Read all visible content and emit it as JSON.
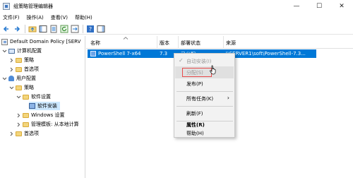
{
  "window": {
    "title": "组策略管理编辑器",
    "controls": {
      "minimize": "—",
      "maximize": "☐",
      "close": "✕"
    }
  },
  "menu": [
    "文件(F)",
    "操作(A)",
    "查看(V)",
    "帮助(H)"
  ],
  "tree": {
    "root": "Default Domain Policy [SERV",
    "computer_config": "计算机配置",
    "policies": "策略",
    "preferences": "首选项",
    "user_config": "用户配置",
    "user_policies": "策略",
    "software_settings": "软件设置",
    "software_install": "软件安装",
    "windows_settings": "Windows 设置",
    "admin_templates": "管理模板: 从本地计算",
    "user_preferences": "首选项"
  },
  "list": {
    "columns": [
      "名称",
      "版本",
      "部署状态",
      "来源"
    ],
    "rows": [
      {
        "name": "PowerShell 7-x64",
        "version": "7.3",
        "status": "已分配",
        "source": "\\\\SERVER1\\soft\\PowerShell-7.3..."
      }
    ]
  },
  "context_menu": {
    "auto_install": "自动安装(I)",
    "assign": "分配(S)",
    "publish": "发布(P)",
    "all_tasks": "所有任务(K)",
    "refresh": "刷新(F)",
    "properties": "属性(R)",
    "help": "帮助(H)"
  }
}
